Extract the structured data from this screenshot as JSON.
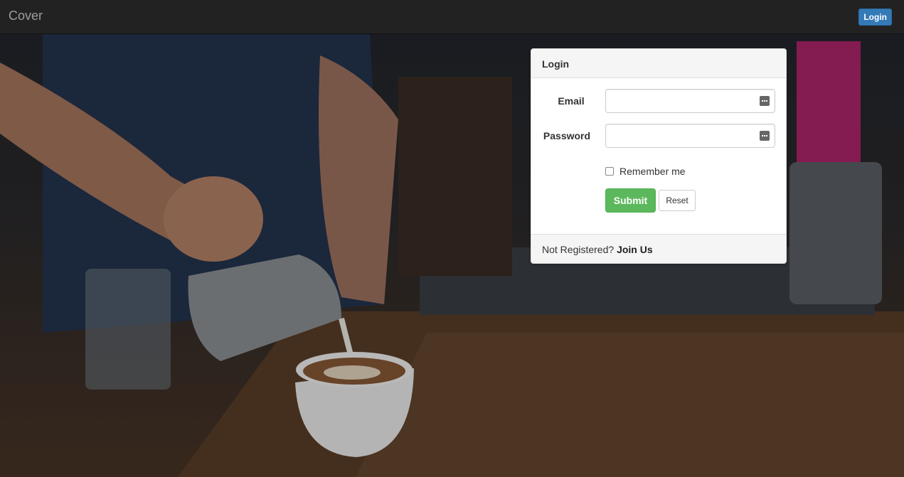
{
  "navbar": {
    "brand": "Cover",
    "login_label": "Login"
  },
  "login_panel": {
    "title": "Login",
    "email_label": "Email",
    "email_value": "",
    "password_label": "Password",
    "password_value": "",
    "remember_label": "Remember me",
    "remember_checked": false,
    "submit_label": "Submit",
    "reset_label": "Reset",
    "footer_text": "Not Registered?",
    "footer_link": "Join Us"
  },
  "icons": {
    "field_icon": "keyboard-icon"
  },
  "colors": {
    "navbar_bg": "#222222",
    "login_button": "#337ab7",
    "submit_button": "#5cb85c"
  }
}
